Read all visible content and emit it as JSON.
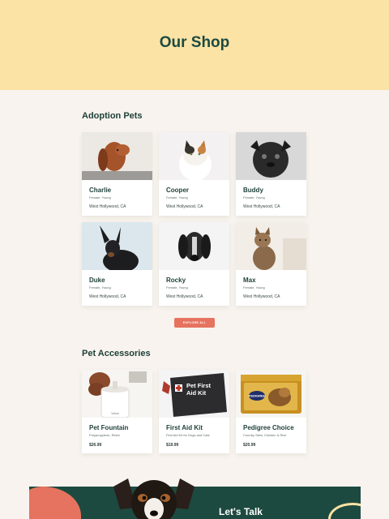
{
  "hero": {
    "title": "Our Shop"
  },
  "adoption": {
    "title": "Adoption Pets",
    "pets": [
      {
        "name": "Charlie",
        "info": "Female, Young",
        "location": "West Hollywood, CA"
      },
      {
        "name": "Cooper",
        "info": "Female, Young",
        "location": "West Hollywood, CA"
      },
      {
        "name": "Buddy",
        "info": "Female, Young",
        "location": "West Hollywood, CA"
      },
      {
        "name": "Duke",
        "info": "Female, Young",
        "location": "West Hollywood, CA"
      },
      {
        "name": "Rocky",
        "info": "Female, Young",
        "location": "West Hollywood, CA"
      },
      {
        "name": "Max",
        "info": "Female, Young",
        "location": "West Hollywood, CA"
      }
    ],
    "explore_label": "EXPLORE ALL"
  },
  "accessories": {
    "title": "Pet Accessories",
    "items": [
      {
        "name": "Pet Fountain",
        "desc": "Polypropylene, Resin",
        "price": "$26.99",
        "photo_text": "Vokos"
      },
      {
        "name": "First Aid Kit",
        "desc": "First Aid Kit for Dogs and Cats",
        "price": "$19.99",
        "photo_text": "Pet First Aid Kit"
      },
      {
        "name": "Pedigree Choice",
        "desc": "Country Stew, Chicken & Rice",
        "price": "$20.99",
        "photo_text": "PEDIGREE"
      }
    ]
  },
  "footer": {
    "cta": "Let's Talk"
  },
  "colors": {
    "hero_bg": "#fbe3a6",
    "accent": "#e6735f",
    "dark_green": "#1d4a40",
    "page_bg": "#f8f3ee"
  }
}
